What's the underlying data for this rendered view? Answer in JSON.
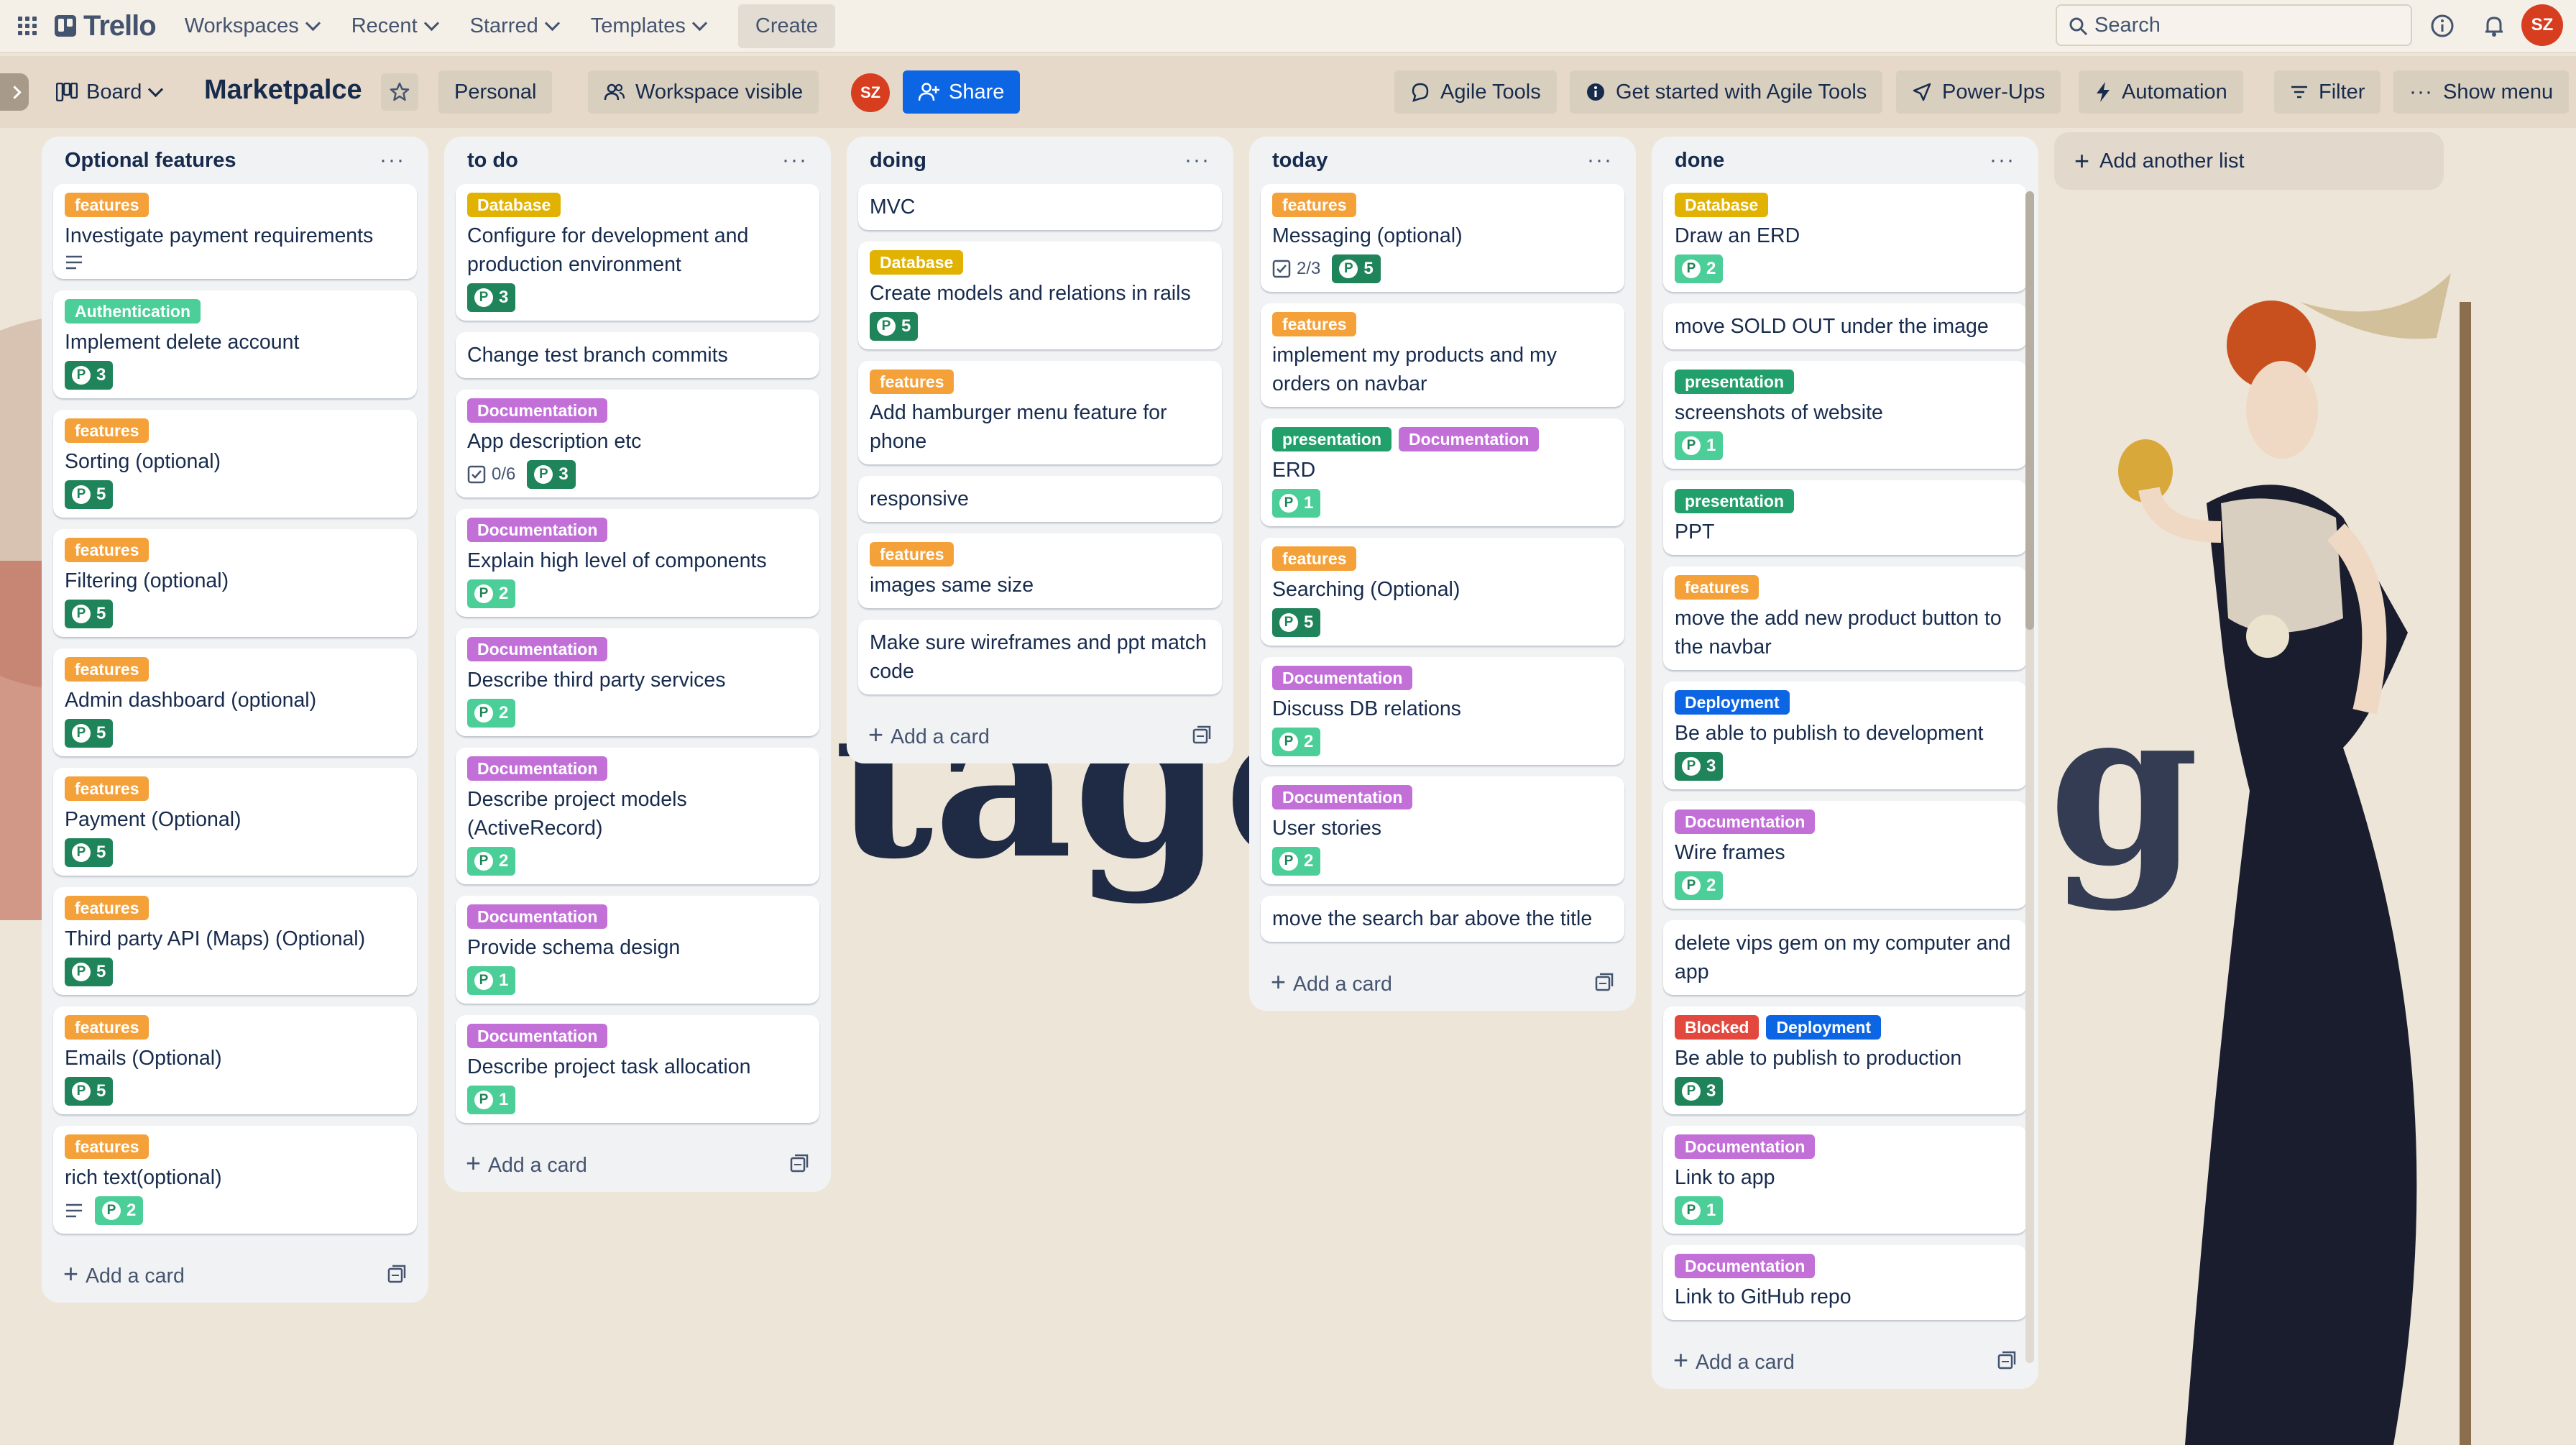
{
  "nav": {
    "logo": "Trello",
    "menus": [
      "Workspaces",
      "Recent",
      "Starred",
      "Templates"
    ],
    "create": "Create",
    "search_placeholder": "Search",
    "user_initials": "SZ"
  },
  "board": {
    "view": "Board",
    "title": "Marketpalce",
    "workspace": "Personal",
    "visibility": "Workspace visible",
    "share": "Share",
    "agile_tools": "Agile Tools",
    "get_started": "Get started with Agile Tools",
    "power_ups": "Power-Ups",
    "automation": "Automation",
    "filter": "Filter",
    "show_menu": "Show menu",
    "add_list": "Add another list",
    "add_card": "Add a card"
  },
  "label_colors": {
    "features": "#f5a13a",
    "Database": "#e2b203",
    "Authentication": "#4bce97",
    "Documentation": "#c270d8",
    "presentation": "#22a06b",
    "Deployment": "#0c66e4",
    "Blocked": "#e2483d"
  },
  "lists": [
    {
      "title": "Optional features",
      "cards": [
        {
          "labels": [
            "features"
          ],
          "title": "Investigate payment requirements",
          "desc": true
        },
        {
          "labels": [
            "Authentication"
          ],
          "title": "Implement delete account",
          "points": "3",
          "dark": true
        },
        {
          "labels": [
            "features"
          ],
          "title": "Sorting (optional)",
          "points": "5",
          "dark": true
        },
        {
          "labels": [
            "features"
          ],
          "title": "Filtering (optional)",
          "points": "5",
          "dark": true
        },
        {
          "labels": [
            "features"
          ],
          "title": "Admin dashboard (optional)",
          "points": "5",
          "dark": true
        },
        {
          "labels": [
            "features"
          ],
          "title": "Payment (Optional)",
          "points": "5",
          "dark": true
        },
        {
          "labels": [
            "features"
          ],
          "title": "Third party API (Maps) (Optional)",
          "points": "5",
          "dark": true
        },
        {
          "labels": [
            "features"
          ],
          "title": "Emails (Optional)",
          "points": "5",
          "dark": true
        },
        {
          "labels": [
            "features"
          ],
          "title": "rich text(optional)",
          "desc": true,
          "points": "2"
        }
      ]
    },
    {
      "title": "to do",
      "cards": [
        {
          "labels": [
            "Database"
          ],
          "title": "Configure for development and production environment",
          "points": "3",
          "dark": true
        },
        {
          "labels": [],
          "title": "Change test branch commits"
        },
        {
          "labels": [
            "Documentation"
          ],
          "title": "App description etc",
          "checklist": "0/6",
          "points": "3",
          "dark": true
        },
        {
          "labels": [
            "Documentation"
          ],
          "title": "Explain high level of components",
          "points": "2"
        },
        {
          "labels": [
            "Documentation"
          ],
          "title": "Describe third party services",
          "points": "2"
        },
        {
          "labels": [
            "Documentation"
          ],
          "title": "Describe project models (ActiveRecord)",
          "points": "2"
        },
        {
          "labels": [
            "Documentation"
          ],
          "title": "Provide schema design",
          "points": "1"
        },
        {
          "labels": [
            "Documentation"
          ],
          "title": "Describe project task allocation",
          "points": "1"
        }
      ]
    },
    {
      "title": "doing",
      "cards": [
        {
          "labels": [],
          "title": "MVC"
        },
        {
          "labels": [
            "Database"
          ],
          "title": "Create models and relations in rails",
          "points": "5",
          "dark": true
        },
        {
          "labels": [
            "features"
          ],
          "title": "Add hamburger menu feature for phone"
        },
        {
          "labels": [],
          "title": "responsive"
        },
        {
          "labels": [
            "features"
          ],
          "title": "images same size"
        },
        {
          "labels": [],
          "title": "Make sure wireframes and ppt match code"
        }
      ]
    },
    {
      "title": "today",
      "cards": [
        {
          "labels": [
            "features"
          ],
          "title": "Messaging (optional)",
          "checklist": "2/3",
          "points": "5",
          "dark": true
        },
        {
          "labels": [
            "features"
          ],
          "title": "implement my products and my orders on navbar"
        },
        {
          "labels": [
            "presentation",
            "Documentation"
          ],
          "title": "ERD",
          "points": "1"
        },
        {
          "labels": [
            "features"
          ],
          "title": "Searching (Optional)",
          "points": "5",
          "dark": true
        },
        {
          "labels": [
            "Documentation"
          ],
          "title": "Discuss DB relations",
          "points": "2"
        },
        {
          "labels": [
            "Documentation"
          ],
          "title": "User stories",
          "points": "2"
        },
        {
          "labels": [],
          "title": "move the search bar above the title"
        }
      ]
    },
    {
      "title": "done",
      "cards": [
        {
          "labels": [
            "Database"
          ],
          "title": "Draw an ERD",
          "points": "2"
        },
        {
          "labels": [],
          "title": "move SOLD OUT under the image"
        },
        {
          "labels": [
            "presentation"
          ],
          "title": "screenshots of website",
          "points": "1"
        },
        {
          "labels": [
            "presentation"
          ],
          "title": "PPT"
        },
        {
          "labels": [
            "features"
          ],
          "title": "move the add new product button to the navbar"
        },
        {
          "labels": [
            "Deployment"
          ],
          "title": "Be able to publish to development",
          "points": "3",
          "dark": true
        },
        {
          "labels": [
            "Documentation"
          ],
          "title": "Wire frames",
          "points": "2"
        },
        {
          "labels": [],
          "title": "delete vips gem on my computer and app"
        },
        {
          "labels": [
            "Blocked",
            "Deployment"
          ],
          "title": "Be able to publish to production",
          "points": "3",
          "dark": true
        },
        {
          "labels": [
            "Documentation"
          ],
          "title": "Link to app",
          "points": "1"
        },
        {
          "labels": [
            "Documentation"
          ],
          "title": "Link to GitHub repo"
        }
      ]
    }
  ]
}
